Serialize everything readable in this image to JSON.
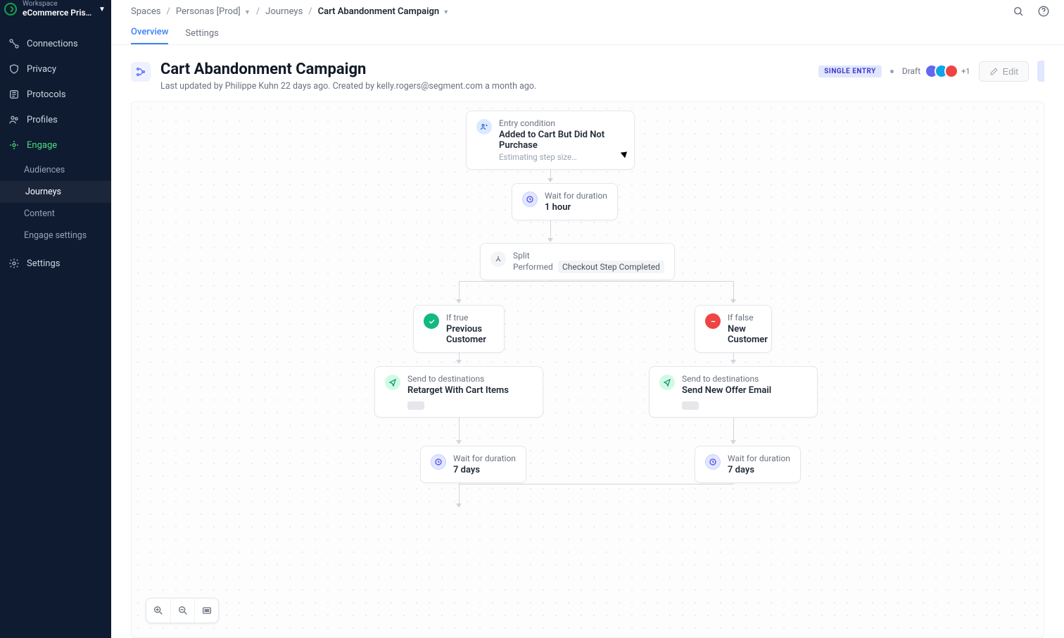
{
  "workspace": {
    "label": "Workspace",
    "name": "eCommerce Pristi…"
  },
  "sidebar": {
    "items": [
      {
        "label": "Connections",
        "icon": "connections"
      },
      {
        "label": "Privacy",
        "icon": "shield"
      },
      {
        "label": "Protocols",
        "icon": "protocols"
      },
      {
        "label": "Profiles",
        "icon": "profiles"
      },
      {
        "label": "Engage",
        "icon": "engage",
        "active": true
      },
      {
        "label": "Settings",
        "icon": "gear"
      }
    ],
    "engage_sub": [
      {
        "label": "Audiences"
      },
      {
        "label": "Journeys",
        "active": true
      },
      {
        "label": "Content"
      },
      {
        "label": "Engage settings"
      }
    ]
  },
  "breadcrumb": {
    "spaces": "Spaces",
    "personas": "Personas [Prod]",
    "journeys": "Journeys",
    "current": "Cart Abandonment Campaign"
  },
  "tabs": {
    "overview": "Overview",
    "settings": "Settings"
  },
  "header": {
    "title": "Cart Abandonment Campaign",
    "subtitle": "Last updated by Philippe Kuhn 22 days ago. Created by kelly.rogers@segment.com a month ago.",
    "pill": "SINGLE ENTRY",
    "status": "Draft",
    "avatars_more": "+1",
    "edit": "Edit"
  },
  "canvas": {
    "entry": {
      "label": "Entry condition",
      "title": "Added to Cart But Did Not Purchase",
      "sub": "Estimating step size…"
    },
    "wait1": {
      "label": "Wait for duration",
      "title": "1 hour"
    },
    "split": {
      "label": "Split",
      "perf": "Performed",
      "event": "Checkout Step Completed"
    },
    "true": {
      "label": "If true",
      "title": "Previous Customer"
    },
    "false": {
      "label": "If false",
      "title": "New Customer"
    },
    "destL": {
      "label": "Send to destinations",
      "title": "Retarget With Cart Items"
    },
    "destR": {
      "label": "Send to destinations",
      "title": "Send New Offer Email"
    },
    "waitL": {
      "label": "Wait for duration",
      "title": "7 days"
    },
    "waitR": {
      "label": "Wait for duration",
      "title": "7 days"
    }
  }
}
